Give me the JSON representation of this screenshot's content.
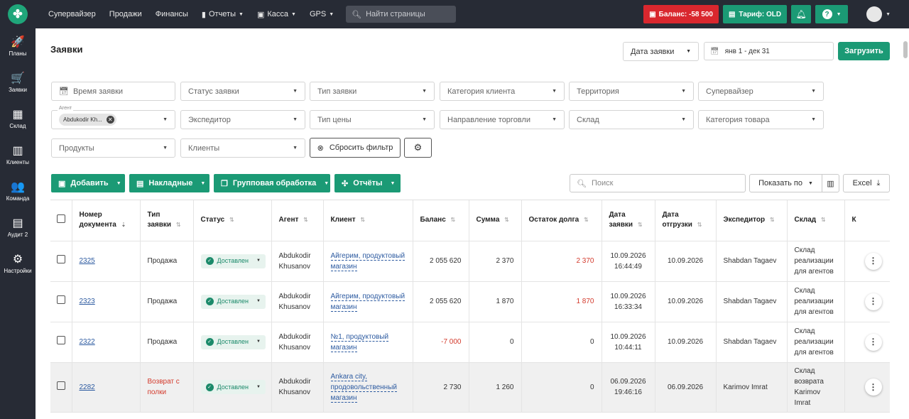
{
  "topbar": {
    "nav": [
      {
        "label": "Супервайзер",
        "has_caret": false,
        "icon": ""
      },
      {
        "label": "Продажи",
        "has_caret": false,
        "icon": ""
      },
      {
        "label": "Финансы",
        "has_caret": false,
        "icon": ""
      },
      {
        "label": "Отчеты",
        "has_caret": true,
        "icon": "bar-chart-icon"
      },
      {
        "label": "Касса",
        "has_caret": true,
        "icon": "register-icon"
      },
      {
        "label": "GPS",
        "has_caret": true,
        "icon": ""
      }
    ],
    "search_placeholder": "Найти страницы",
    "balance_label": "Баланс: -58 500",
    "tariff_label": "Тариф: OLD",
    "help_icon": "?",
    "colors": {
      "bar": "#272b35",
      "danger": "#d9272e",
      "accent": "#1b9a75"
    }
  },
  "sidebar": {
    "items": [
      {
        "label": "Планы",
        "icon": "rocket-icon",
        "glyph": "🚀"
      },
      {
        "label": "Заявки",
        "icon": "cart-icon",
        "glyph": "🛒"
      },
      {
        "label": "Склад",
        "icon": "warehouse-icon",
        "glyph": "▦"
      },
      {
        "label": "Клиенты",
        "icon": "building-icon",
        "glyph": "▥"
      },
      {
        "label": "Команда",
        "icon": "team-icon",
        "glyph": "👥"
      },
      {
        "label": "Аудит 2",
        "icon": "audit-icon",
        "glyph": "▤"
      },
      {
        "label": "Настройки",
        "icon": "gear-icon",
        "glyph": "⚙"
      }
    ]
  },
  "page": {
    "title": "Заявки",
    "date_type": "Дата заявки",
    "date_range": "янв 1 - дек 31",
    "load_label": "Загрузить"
  },
  "filters": {
    "time": "Время заявки",
    "status": "Статус заявки",
    "type": "Тип заявки",
    "client_category": "Категория клиента",
    "territory": "Территория",
    "supervisor": "Супервайзер",
    "agent_label": "Агент",
    "agent_chip": "Abdukodir Kh...",
    "expeditor": "Экспедитор",
    "price_type": "Тип цены",
    "trade_direction": "Направление торговли",
    "warehouse": "Склад",
    "product_category": "Категория товара",
    "products": "Продукты",
    "clients": "Клиенты",
    "reset_label": "Сбросить фильтр"
  },
  "toolbar": {
    "add": "Добавить",
    "invoices": "Накладные",
    "group": "Групповая обработка",
    "reports": "Отчёты",
    "search_placeholder": "Поиск",
    "show_by": "Показать по",
    "excel": "Excel"
  },
  "table": {
    "headers": {
      "number": "Номер документа",
      "type": "Тип заявки",
      "status": "Статус",
      "agent": "Агент",
      "client": "Клиент",
      "balance": "Баланс",
      "sum": "Сумма",
      "debt": "Остаток долга",
      "order_date": "Дата заявки",
      "ship_date": "Дата отгрузки",
      "expeditor": "Экспедитор",
      "warehouse": "Склад",
      "extra": "К"
    },
    "rows": [
      {
        "number": "2325",
        "type": "Продажа",
        "type_red": false,
        "status": "Доставлен",
        "agent": "Abdukodir Khusanov",
        "client": "Айгерим, продуктовый магазин",
        "balance": "2 055 620",
        "balance_red": false,
        "sum": "2 370",
        "debt": "2 370",
        "debt_red": true,
        "order_date": "10.09.2026 16:44:49",
        "ship_date": "10.09.2026",
        "expeditor": "Shabdan Tagaev",
        "warehouse": "Склад реализации для агентов",
        "gray": false
      },
      {
        "number": "2323",
        "type": "Продажа",
        "type_red": false,
        "status": "Доставлен",
        "agent": "Abdukodir Khusanov",
        "client": "Айгерим, продуктовый магазин",
        "balance": "2 055 620",
        "balance_red": false,
        "sum": "1 870",
        "debt": "1 870",
        "debt_red": true,
        "order_date": "10.09.2026 16:33:34",
        "ship_date": "10.09.2026",
        "expeditor": "Shabdan Tagaev",
        "warehouse": "Склад реализации для агентов",
        "gray": false
      },
      {
        "number": "2322",
        "type": "Продажа",
        "type_red": false,
        "status": "Доставлен",
        "agent": "Abdukodir Khusanov",
        "client": "№1, продуктовый магазин",
        "balance": "-7 000",
        "balance_red": true,
        "sum": "0",
        "debt": "0",
        "debt_red": false,
        "order_date": "10.09.2026 10:44:11",
        "ship_date": "10.09.2026",
        "expeditor": "Shabdan Tagaev",
        "warehouse": "Склад реализации для агентов",
        "gray": false
      },
      {
        "number": "2282",
        "type": "Возврат с полки",
        "type_red": true,
        "status": "Доставлен",
        "agent": "Abdukodir Khusanov",
        "client": "Ankara city, продовольственный магазин",
        "balance": "2 730",
        "balance_red": false,
        "sum": "1 260",
        "debt": "0",
        "debt_red": false,
        "order_date": "06.09.2026 19:46:16",
        "ship_date": "06.09.2026",
        "expeditor": "Karimov Imrat",
        "warehouse": "Склад возврата Karimov Imrat",
        "gray": true
      }
    ]
  }
}
